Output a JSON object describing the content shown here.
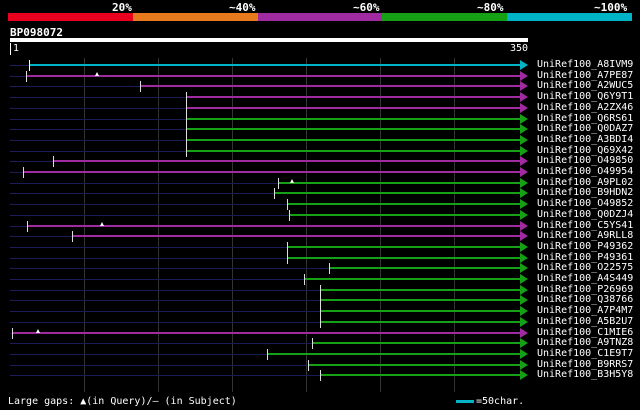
{
  "legend": {
    "colors": [
      "#e8001e",
      "#e87a1e",
      "#a02aa0",
      "#15a015",
      "#00b4c8"
    ],
    "labels": [
      "20%",
      "~40%",
      "~60%",
      "~80%",
      "~100%"
    ]
  },
  "query": {
    "id": "BP098072",
    "start": "1",
    "end": "350"
  },
  "hits": [
    {
      "id": "UniRef100_A8IVM9",
      "color": "#00b4c8",
      "start": 0.038,
      "gapmark": null
    },
    {
      "id": "UniRef100_A7PE87",
      "color": "#a02aa0",
      "start": 0.031,
      "gapmark": 0.171
    },
    {
      "id": "UniRef100_A2WUC5",
      "color": "#a02aa0",
      "start": 0.254,
      "gapmark": null
    },
    {
      "id": "UniRef100_Q6Y9T1",
      "color": "#a02aa0",
      "start": 0.346,
      "gapmark": null
    },
    {
      "id": "UniRef100_A2ZX46",
      "color": "#a02aa0",
      "start": 0.346,
      "gapmark": null
    },
    {
      "id": "UniRef100_Q6RS61",
      "color": "#15a015",
      "start": 0.346,
      "gapmark": null
    },
    {
      "id": "UniRef100_Q0DAZ7",
      "color": "#15a015",
      "start": 0.346,
      "gapmark": null
    },
    {
      "id": "UniRef100_A3BDI4",
      "color": "#15a015",
      "start": 0.346,
      "gapmark": null
    },
    {
      "id": "UniRef100_Q69X42",
      "color": "#15a015",
      "start": 0.346,
      "gapmark": null
    },
    {
      "id": "UniRef100_O49850",
      "color": "#a02aa0",
      "start": 0.085,
      "gapmark": null
    },
    {
      "id": "UniRef100_O49954",
      "color": "#a02aa0",
      "start": 0.025,
      "gapmark": null
    },
    {
      "id": "UniRef100_A9PL02",
      "color": "#15a015",
      "start": 0.525,
      "gapmark": 0.552
    },
    {
      "id": "UniRef100_B9HDN2",
      "color": "#15a015",
      "start": 0.517,
      "gapmark": null
    },
    {
      "id": "UniRef100_O49852",
      "color": "#15a015",
      "start": 0.544,
      "gapmark": null
    },
    {
      "id": "UniRef100_Q0DZJ4",
      "color": "#15a015",
      "start": 0.548,
      "gapmark": null
    },
    {
      "id": "UniRef100_C5YS41",
      "color": "#a02aa0",
      "start": 0.033,
      "gapmark": 0.181
    },
    {
      "id": "UniRef100_A9RLL8",
      "color": "#a02aa0",
      "start": 0.121,
      "gapmark": null
    },
    {
      "id": "UniRef100_P49362",
      "color": "#15a015",
      "start": 0.544,
      "gapmark": null
    },
    {
      "id": "UniRef100_P49361",
      "color": "#15a015",
      "start": 0.544,
      "gapmark": null
    },
    {
      "id": "UniRef100_O22575",
      "color": "#15a015",
      "start": 0.625,
      "gapmark": null
    },
    {
      "id": "UniRef100_A4S449",
      "color": "#15a015",
      "start": 0.577,
      "gapmark": null
    },
    {
      "id": "UniRef100_P26969",
      "color": "#15a015",
      "start": 0.608,
      "gapmark": null
    },
    {
      "id": "UniRef100_Q38766",
      "color": "#15a015",
      "start": 0.608,
      "gapmark": null
    },
    {
      "id": "UniRef100_A7P4M7",
      "color": "#15a015",
      "start": 0.608,
      "gapmark": null
    },
    {
      "id": "UniRef100_A5B2U7",
      "color": "#15a015",
      "start": 0.608,
      "gapmark": null
    },
    {
      "id": "UniRef100_C1MIE6",
      "color": "#a02aa0",
      "start": 0.004,
      "gapmark": 0.054
    },
    {
      "id": "UniRef100_A9TNZ8",
      "color": "#15a015",
      "start": 0.592,
      "gapmark": null
    },
    {
      "id": "UniRef100_C1E9T7",
      "color": "#15a015",
      "start": 0.504,
      "gapmark": null
    },
    {
      "id": "UniRef100_B9RRS7",
      "color": "#15a015",
      "start": 0.585,
      "gapmark": null
    },
    {
      "id": "UniRef100_B3H5Y8",
      "color": "#15a015",
      "start": 0.608,
      "gapmark": null
    }
  ],
  "footer": {
    "gaps_text": "Large gaps: ▲(in Query)/– (in Subject)",
    "scale_text": "=50char."
  }
}
